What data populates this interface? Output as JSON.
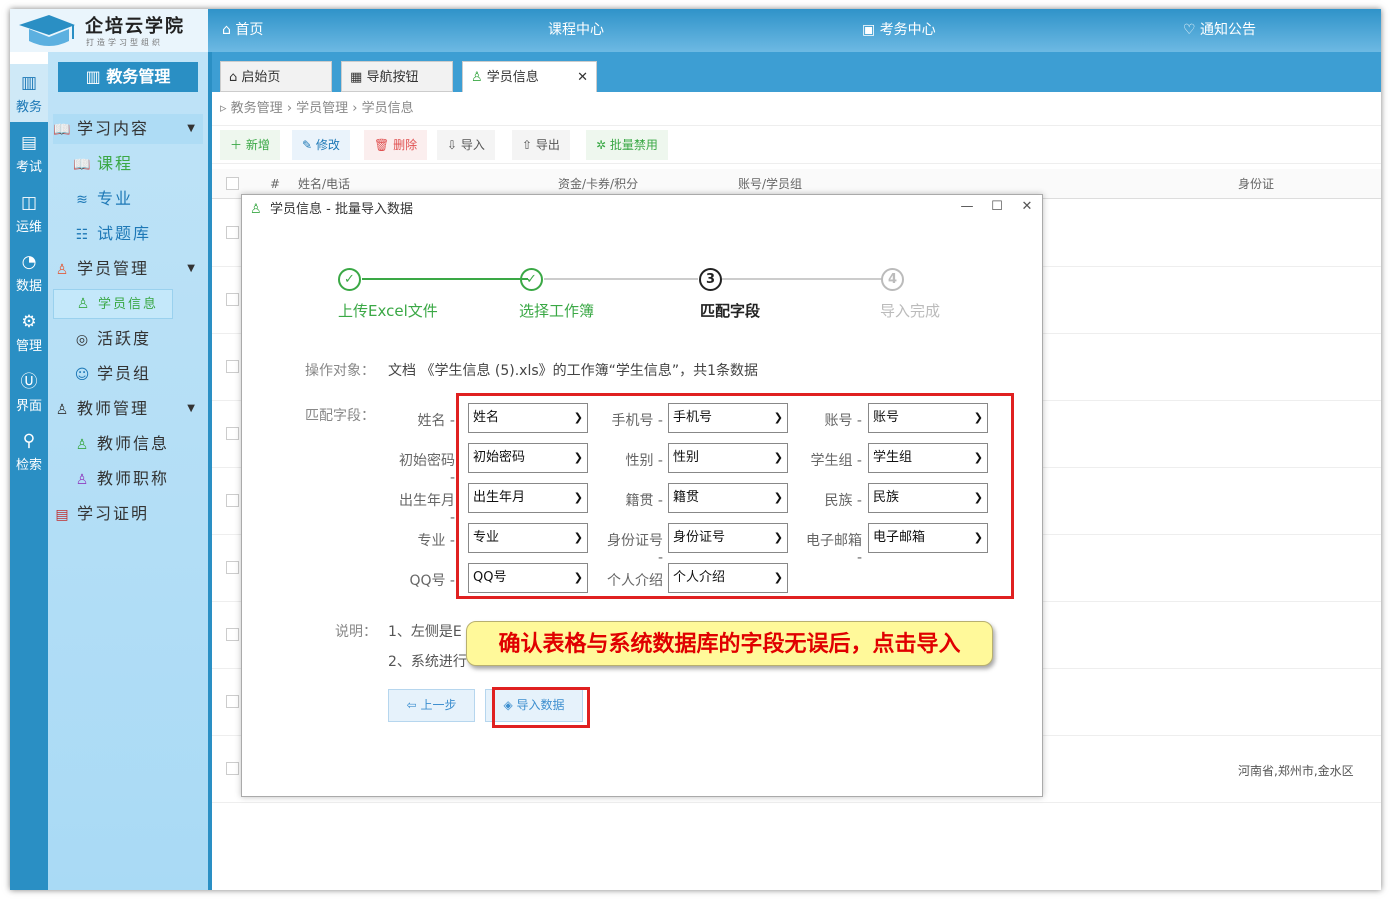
{
  "logo": {
    "title": "企培云学院",
    "slogan": "打造学习型组织"
  },
  "topnav": {
    "home": "首页",
    "courses": "课程中心",
    "exams": "考务中心",
    "notice": "通知公告"
  },
  "rail": [
    "教务",
    "考试",
    "运维",
    "数据",
    "管理",
    "界面",
    "检索"
  ],
  "sidebar": {
    "header": "教务管理",
    "items": [
      "学习内容",
      "课程",
      "专业",
      "试题库",
      "学员管理",
      "学员信息",
      "活跃度",
      "学员组",
      "教师管理",
      "教师信息",
      "教师职称",
      "学习证明"
    ]
  },
  "tabs": [
    "启始页",
    "导航按钮",
    "学员信息"
  ],
  "breadcrumb": [
    "教务管理",
    "学员管理",
    "学员信息"
  ],
  "toolbar": [
    "新增",
    "修改",
    "删除",
    "导入",
    "导出",
    "批量禁用"
  ],
  "table": {
    "headers": [
      "#",
      "姓名/电话",
      "资金/卡券/积分",
      "账号/学员组",
      "身份证"
    ],
    "visible_cell": "河南省,郑州市,金水区"
  },
  "dialog": {
    "title": "学员信息 - 批量导入数据",
    "steps": [
      {
        "num": "✓",
        "label": "上传Excel文件",
        "state": "done"
      },
      {
        "num": "✓",
        "label": "选择工作簿",
        "state": "done"
      },
      {
        "num": "3",
        "label": "匹配字段",
        "state": "current"
      },
      {
        "num": "4",
        "label": "导入完成",
        "state": "todo"
      }
    ],
    "target_label": "操作对象：",
    "target_text": "文档 《学生信息 (5).xls》的工作簿“学生信息”，共1条数据",
    "match_label": "匹配字段：",
    "fields": [
      {
        "label": "姓名",
        "value": "姓名"
      },
      {
        "label": "手机号",
        "value": "手机号"
      },
      {
        "label": "账号",
        "value": "账号"
      },
      {
        "label": "初始密码",
        "value": "初始密码"
      },
      {
        "label": "性别",
        "value": "性别"
      },
      {
        "label": "学生组",
        "value": "学生组"
      },
      {
        "label": "出生年月",
        "value": "出生年月"
      },
      {
        "label": "籍贯",
        "value": "籍贯"
      },
      {
        "label": "民族",
        "value": "民族"
      },
      {
        "label": "专业",
        "value": "专业"
      },
      {
        "label": "身份证号",
        "value": "身份证号"
      },
      {
        "label": "电子邮箱",
        "value": "电子邮箱"
      },
      {
        "label": "QQ号",
        "value": "QQ号"
      },
      {
        "label": "个人介绍",
        "value": "个人介绍"
      }
    ],
    "note_label": "说明：",
    "note1": "1、左侧是E",
    "note2": "2、系统进行",
    "prev_button": "上一步",
    "import_button": "导入数据"
  },
  "callout": "确认表格与系统数据库的字段无误后，点击导入",
  "colors": {
    "primary": "#2a8fc4",
    "green": "#3aa845",
    "red": "#e02020",
    "callout_bg": "#fff99a"
  }
}
